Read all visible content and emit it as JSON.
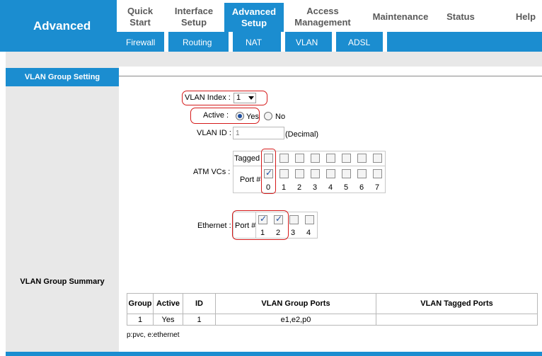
{
  "header": {
    "brand": "Advanced",
    "nav": [
      {
        "line1": "Quick",
        "line2": "Start"
      },
      {
        "line1": "Interface",
        "line2": "Setup"
      },
      {
        "line1": "Advanced",
        "line2": "Setup"
      },
      {
        "line1": "Access",
        "line2": "Management"
      },
      {
        "line1": "Maintenance",
        "line2": ""
      },
      {
        "line1": "Status",
        "line2": ""
      },
      {
        "line1": "Help",
        "line2": ""
      }
    ],
    "active_nav": "Advanced Setup",
    "subnav": [
      "Firewall",
      "Routing",
      "NAT",
      "VLAN",
      "ADSL"
    ]
  },
  "sidebar": {
    "section_title": "VLAN Group Setting",
    "summary_title": "VLAN Group Summary"
  },
  "form": {
    "vlan_index_label": "VLAN Index :",
    "vlan_index_value": "1",
    "active_label": "Active :",
    "active_yes": "Yes",
    "active_no": "No",
    "active_selected": "Yes",
    "vlan_id_label": "VLAN ID :",
    "vlan_id_placeholder": "1",
    "vlan_id_hint": "(Decimal)",
    "atm_label": "ATM VCs :",
    "tagged_label": "Tagged",
    "port_label": "Port #",
    "atm_ports": [
      "0",
      "1",
      "2",
      "3",
      "4",
      "5",
      "6",
      "7"
    ],
    "atm_tagged": [
      false,
      false,
      false,
      false,
      false,
      false,
      false,
      false
    ],
    "atm_port_checked": [
      true,
      false,
      false,
      false,
      false,
      false,
      false,
      false
    ],
    "ethernet_label": "Ethernet :",
    "eth_ports": [
      "1",
      "2",
      "3",
      "4"
    ],
    "eth_port_checked": [
      true,
      true,
      false,
      false
    ]
  },
  "summary": {
    "columns": [
      "Group",
      "Active",
      "ID",
      "VLAN Group Ports",
      "VLAN Tagged Ports"
    ],
    "rows": [
      {
        "group": "1",
        "active": "Yes",
        "id": "1",
        "ports": "e1,e2,p0",
        "tagged": ""
      }
    ],
    "legend": "p:pvc, e:ethernet"
  },
  "colors": {
    "brand_blue": "#1b8dd0",
    "panel_gray": "#e8e8e8",
    "highlight_red": "#d51a1a"
  }
}
